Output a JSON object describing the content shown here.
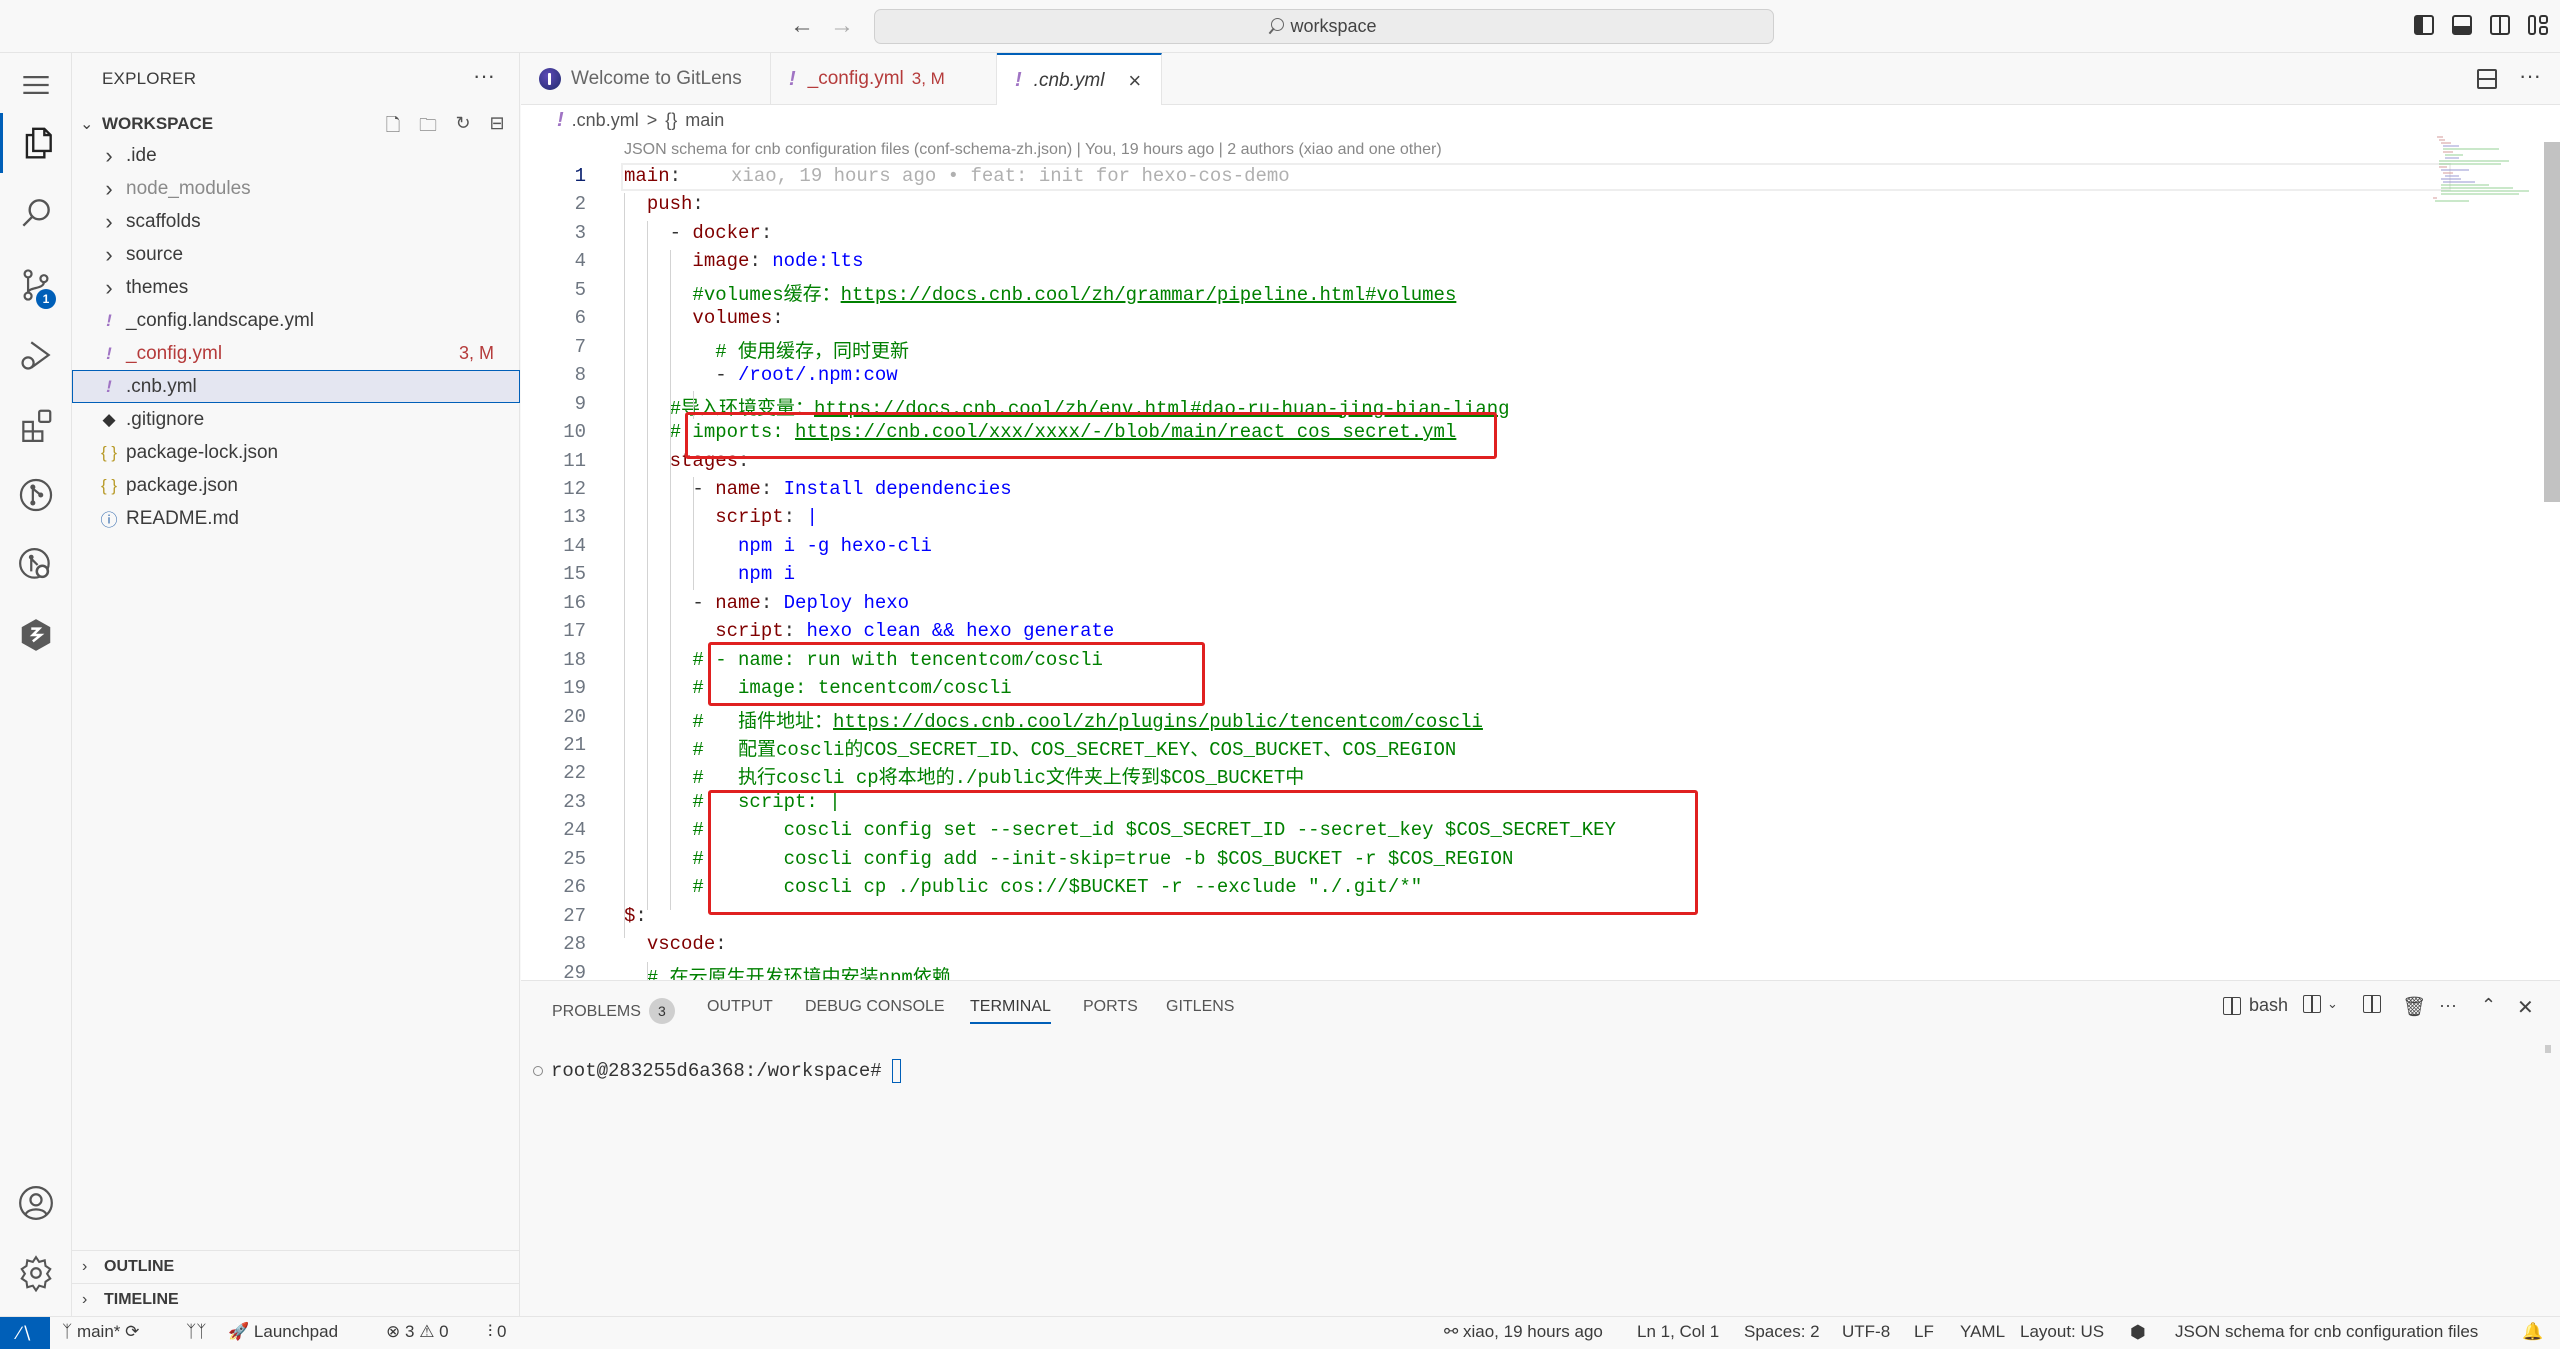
{
  "titlebar": {
    "search_text": "workspace",
    "back_icon": "arrow-left-icon",
    "forward_icon": "arrow-right-icon",
    "layout_icons": [
      "toggle-primary-sidebar-icon",
      "toggle-panel-icon",
      "toggle-secondary-sidebar-icon",
      "customize-layout-icon"
    ]
  },
  "activity_bar": {
    "items": [
      {
        "name": "menu",
        "icon": "hamburger-icon"
      },
      {
        "name": "explorer",
        "icon": "files-icon",
        "active": true
      },
      {
        "name": "search",
        "icon": "search-icon"
      },
      {
        "name": "source-control",
        "icon": "source-control-icon",
        "badge": "1"
      },
      {
        "name": "run-debug",
        "icon": "debug-icon"
      },
      {
        "name": "extensions",
        "icon": "extensions-icon"
      },
      {
        "name": "gitlens",
        "icon": "gitlens-icon"
      },
      {
        "name": "gitlens-inspect",
        "icon": "gitlens-inspect-icon"
      },
      {
        "name": "cnb",
        "icon": "cnb-icon"
      }
    ],
    "bottom": [
      {
        "name": "accounts",
        "icon": "account-icon"
      },
      {
        "name": "manage",
        "icon": "gear-icon"
      }
    ]
  },
  "sidebar": {
    "title": "EXPLORER",
    "more": "···",
    "workspace": "WORKSPACE",
    "tree": [
      {
        "label": ".ide",
        "type": "folder"
      },
      {
        "label": "node_modules",
        "type": "folder",
        "dimmed": true
      },
      {
        "label": "scaffolds",
        "type": "folder"
      },
      {
        "label": "source",
        "type": "folder"
      },
      {
        "label": "themes",
        "type": "folder"
      },
      {
        "label": "_config.landscape.yml",
        "type": "yml"
      },
      {
        "label": "_config.yml",
        "type": "yml",
        "modified": true,
        "decoration": "3, M"
      },
      {
        "label": ".cnb.yml",
        "type": "yml",
        "selected": true
      },
      {
        "label": ".gitignore",
        "type": "git"
      },
      {
        "label": "package-lock.json",
        "type": "json"
      },
      {
        "label": "package.json",
        "type": "json"
      },
      {
        "label": "README.md",
        "type": "info"
      }
    ],
    "outline": "OUTLINE",
    "timeline": "TIMELINE"
  },
  "tabs": [
    {
      "label": "Welcome to GitLens",
      "icon": "gitlens-logo-icon"
    },
    {
      "label": "_config.yml",
      "decoration": "3, M",
      "icon": "yaml-icon"
    },
    {
      "label": ".cnb.yml",
      "icon": "yaml-icon",
      "active": true,
      "close": "×"
    }
  ],
  "breadcrumb": {
    "file": ".cnb.yml",
    "sep": ">",
    "symbol_icon": "{}",
    "symbol": "main"
  },
  "codelens": "JSON schema for cnb configuration files (conf-schema-zh.json) | You, 19 hours ago | 2 authors (xiao and one other)",
  "blame": "xiao, 19 hours ago • feat: init for hexo-cos-demo",
  "code_lines": [
    {
      "n": "1",
      "parts": [
        [
          "k",
          "main"
        ],
        [
          "p",
          ":"
        ]
      ]
    },
    {
      "n": "2",
      "parts": [
        [
          "p",
          "  "
        ],
        [
          "k",
          "push"
        ],
        [
          "p",
          ":"
        ]
      ]
    },
    {
      "n": "3",
      "parts": [
        [
          "p",
          "    - "
        ],
        [
          "k",
          "docker"
        ],
        [
          "p",
          ":"
        ]
      ]
    },
    {
      "n": "4",
      "parts": [
        [
          "p",
          "      "
        ],
        [
          "k",
          "image"
        ],
        [
          "p",
          ": "
        ],
        [
          "v",
          "node:lts"
        ]
      ]
    },
    {
      "n": "5",
      "parts": [
        [
          "c",
          "      #volumes缓存："
        ],
        [
          "u",
          "https://docs.cnb.cool/zh/grammar/pipeline.html#volumes"
        ]
      ]
    },
    {
      "n": "6",
      "parts": [
        [
          "p",
          "      "
        ],
        [
          "k",
          "volumes"
        ],
        [
          "p",
          ":"
        ]
      ]
    },
    {
      "n": "7",
      "parts": [
        [
          "c",
          "        # 使用缓存，同时更新"
        ]
      ]
    },
    {
      "n": "8",
      "parts": [
        [
          "p",
          "        - "
        ],
        [
          "v",
          "/root/.npm:cow"
        ]
      ]
    },
    {
      "n": "9",
      "parts": [
        [
          "c",
          "    #导入环境变量："
        ],
        [
          "u",
          "https://docs.cnb.cool/zh/env.html#dao-ru-huan-jing-bian-liang"
        ]
      ]
    },
    {
      "n": "10",
      "parts": [
        [
          "c",
          "    # imports: "
        ],
        [
          "u",
          "https://cnb.cool/xxx/xxxx/-/blob/main/react_cos_secret.yml"
        ]
      ]
    },
    {
      "n": "11",
      "parts": [
        [
          "p",
          "    "
        ],
        [
          "k",
          "stages"
        ],
        [
          "p",
          ":"
        ]
      ]
    },
    {
      "n": "12",
      "parts": [
        [
          "p",
          "      - "
        ],
        [
          "k",
          "name"
        ],
        [
          "p",
          ": "
        ],
        [
          "v",
          "Install dependencies"
        ]
      ]
    },
    {
      "n": "13",
      "parts": [
        [
          "p",
          "        "
        ],
        [
          "k",
          "script"
        ],
        [
          "p",
          ": "
        ],
        [
          "v",
          "|"
        ]
      ]
    },
    {
      "n": "14",
      "parts": [
        [
          "p",
          "          "
        ],
        [
          "v",
          "npm i -g hexo-cli"
        ]
      ]
    },
    {
      "n": "15",
      "parts": [
        [
          "p",
          "          "
        ],
        [
          "v",
          "npm i"
        ]
      ]
    },
    {
      "n": "16",
      "parts": [
        [
          "p",
          "      - "
        ],
        [
          "k",
          "name"
        ],
        [
          "p",
          ": "
        ],
        [
          "v",
          "Deploy hexo"
        ]
      ]
    },
    {
      "n": "17",
      "parts": [
        [
          "p",
          "        "
        ],
        [
          "k",
          "script"
        ],
        [
          "p",
          ": "
        ],
        [
          "v",
          "hexo clean && hexo generate"
        ]
      ]
    },
    {
      "n": "18",
      "parts": [
        [
          "c",
          "      # - name: run with tencentcom/coscli"
        ]
      ]
    },
    {
      "n": "19",
      "parts": [
        [
          "c",
          "      #   image: tencentcom/coscli"
        ]
      ]
    },
    {
      "n": "20",
      "parts": [
        [
          "c",
          "      #   插件地址："
        ],
        [
          "u",
          "https://docs.cnb.cool/zh/plugins/public/tencentcom/coscli"
        ]
      ]
    },
    {
      "n": "21",
      "parts": [
        [
          "c",
          "      #   配置coscli的COS_SECRET_ID、COS_SECRET_KEY、COS_BUCKET、COS_REGION"
        ]
      ]
    },
    {
      "n": "22",
      "parts": [
        [
          "c",
          "      #   执行coscli cp将本地的./public文件夹上传到$COS_BUCKET中"
        ]
      ]
    },
    {
      "n": "23",
      "parts": [
        [
          "c",
          "      #   script: |"
        ]
      ]
    },
    {
      "n": "24",
      "parts": [
        [
          "c",
          "      #       coscli config set --secret_id $COS_SECRET_ID --secret_key $COS_SECRET_KEY"
        ]
      ]
    },
    {
      "n": "25",
      "parts": [
        [
          "c",
          "      #       coscli config add --init-skip=true -b $COS_BUCKET -r $COS_REGION"
        ]
      ]
    },
    {
      "n": "26",
      "parts": [
        [
          "c",
          "      #       coscli cp ./public cos://$BUCKET -r --exclude \"./.git/*\""
        ]
      ]
    },
    {
      "n": "27",
      "parts": [
        [
          "k",
          "$"
        ],
        [
          "p",
          ":"
        ]
      ]
    },
    {
      "n": "28",
      "parts": [
        [
          "p",
          "  "
        ],
        [
          "k",
          "vscode"
        ],
        [
          "p",
          ":"
        ]
      ]
    },
    {
      "n": "29",
      "parts": [
        [
          "c",
          "  # 在云原生开发环境中安装npm依赖"
        ]
      ]
    }
  ],
  "panel": {
    "tabs": [
      {
        "label": "PROBLEMS",
        "count": "3"
      },
      {
        "label": "OUTPUT"
      },
      {
        "label": "DEBUG CONSOLE"
      },
      {
        "label": "TERMINAL",
        "active": true
      },
      {
        "label": "PORTS"
      },
      {
        "label": "GITLENS"
      }
    ],
    "terminal_name": "bash",
    "actions": [
      "split-terminal-icon",
      "terminal-dropdown-icon",
      "split-icon",
      "trash-icon",
      "more-icon",
      "maximize-icon",
      "close-icon"
    ],
    "prompt": "root@283255d6a368:/workspace#"
  },
  "statusbar": {
    "remote_icon": "remote-icon",
    "branch": "main*",
    "launchpad": "Launchpad",
    "errors": "3",
    "warnings": "0",
    "ports": "0",
    "blame": "xiao, 19 hours ago",
    "position": "Ln 1, Col 1",
    "spaces": "Spaces: 2",
    "encoding": "UTF-8",
    "eol": "LF",
    "language": "YAML",
    "layout": "Layout: US",
    "schema": "JSON schema for cnb configuration files"
  },
  "colors": {
    "accent": "#005fb8",
    "annotation_box": "#e02020",
    "yaml_key": "#800000",
    "yaml_value": "#0000ff",
    "comment": "#008000"
  }
}
